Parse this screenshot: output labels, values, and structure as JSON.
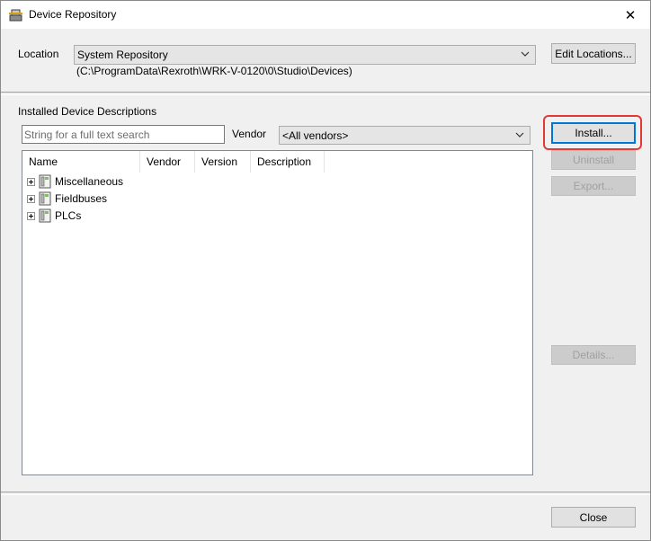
{
  "window": {
    "title": "Device Repository",
    "close_glyph": "✕"
  },
  "location": {
    "label": "Location",
    "selected": "System Repository",
    "path": "(C:\\ProgramData\\Rexroth\\WRK-V-0120\\0\\Studio\\Devices)",
    "edit_button": "Edit Locations..."
  },
  "installed": {
    "heading": "Installed Device Descriptions",
    "search_placeholder": "String for a full text search",
    "vendor_label": "Vendor",
    "vendor_selected": "<All vendors>",
    "columns": [
      "Name",
      "Vendor",
      "Version",
      "Description"
    ],
    "items": [
      {
        "label": "Miscellaneous",
        "icon": "device-folder-icon"
      },
      {
        "label": "Fieldbuses",
        "icon": "device-folder-icon"
      },
      {
        "label": "PLCs",
        "icon": "device-folder-icon"
      }
    ]
  },
  "buttons": {
    "install": "Install...",
    "uninstall": "Uninstall",
    "export": "Export...",
    "details": "Details...",
    "close": "Close"
  },
  "colors": {
    "accent": "#0078d7",
    "highlight": "#e53935"
  }
}
